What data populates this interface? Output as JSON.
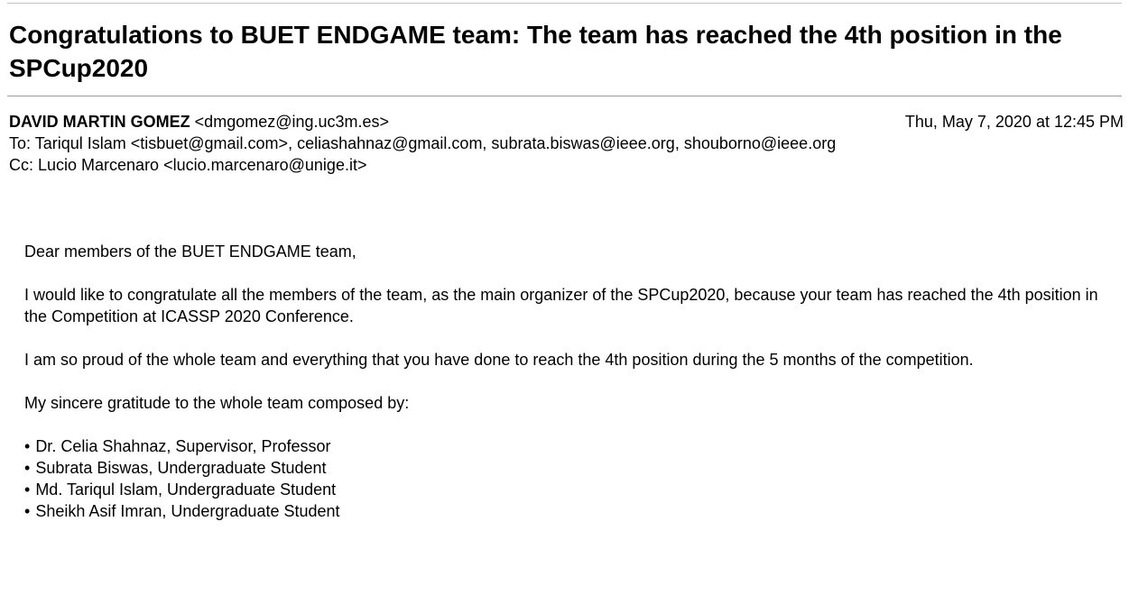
{
  "email": {
    "subject": "Congratulations to BUET ENDGAME team: The team has reached the 4th position in the SPCup2020",
    "from_name": "DAVID MARTIN GOMEZ",
    "from_email": "<dmgomez@ing.uc3m.es>",
    "date": "Thu, May 7, 2020 at 12:45 PM",
    "to_line": "To: Tariqul Islam <tisbuet@gmail.com>, celiashahnaz@gmail.com, subrata.biswas@ieee.org, shouborno@ieee.org",
    "cc_line": "Cc: Lucio Marcenaro <lucio.marcenaro@unige.it>",
    "body": {
      "greeting": "Dear members of the BUET ENDGAME team,",
      "paragraph_1": "I would like to congratulate all the members of the team, as the main organizer of the SPCup2020, because your team has reached the 4th position in the Competition at ICASSP 2020 Conference.",
      "paragraph_2": "I am so proud of the whole team and everything that you have done to reach the 4th position during the 5 months of the competition.",
      "paragraph_3": "My sincere gratitude to the whole team composed by:",
      "bullet_glyph": "•",
      "team_members": [
        "Dr. Celia Shahnaz, Supervisor, Professor",
        "Subrata Biswas, Undergraduate Student",
        "Md. Tariqul Islam, Undergraduate Student",
        "Sheikh Asif Imran, Undergraduate Student"
      ]
    }
  }
}
